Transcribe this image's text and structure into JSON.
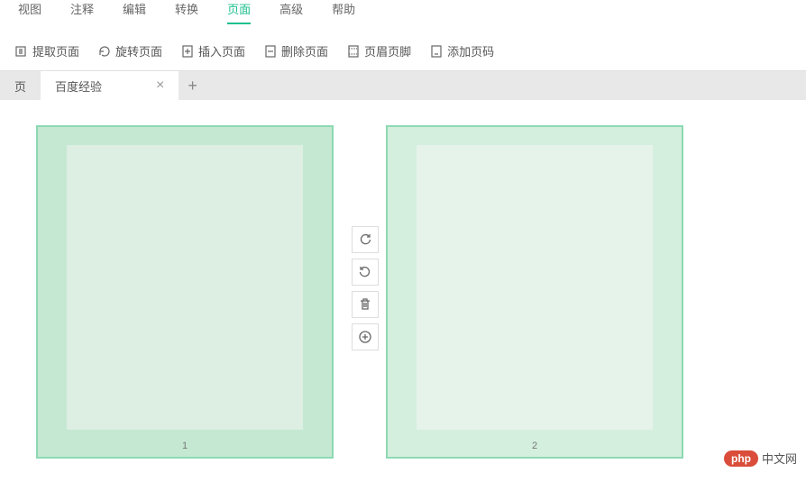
{
  "menu": {
    "items": [
      {
        "label": "视图",
        "active": false
      },
      {
        "label": "注释",
        "active": false
      },
      {
        "label": "编辑",
        "active": false
      },
      {
        "label": "转换",
        "active": false
      },
      {
        "label": "页面",
        "active": true
      },
      {
        "label": "高级",
        "active": false
      },
      {
        "label": "帮助",
        "active": false
      }
    ]
  },
  "toolbar": {
    "extract": "提取页面",
    "rotate": "旋转页面",
    "insert": "插入页面",
    "delete": "删除页面",
    "header": "页眉页脚",
    "pagenum": "添加页码"
  },
  "tabs": {
    "first_partial": "页",
    "items": [
      {
        "label": "百度经验",
        "active": true
      }
    ]
  },
  "pages": [
    {
      "num": "1",
      "selected": true
    },
    {
      "num": "2",
      "selected": false
    }
  ],
  "float": {
    "rotate_cw": "↻",
    "rotate_ccw": "↺",
    "delete": "🗑",
    "add": "+"
  },
  "watermark": {
    "badge": "php",
    "text": "中文网"
  }
}
